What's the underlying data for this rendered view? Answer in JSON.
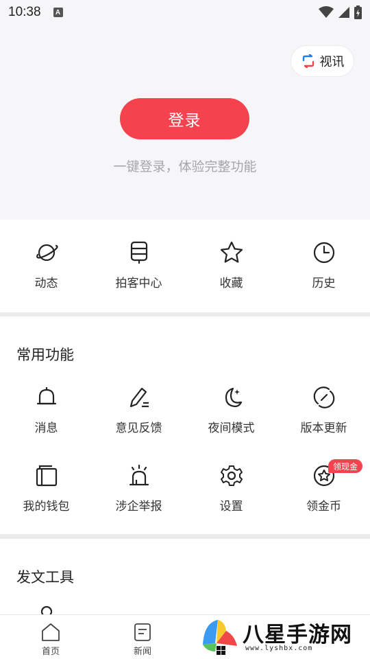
{
  "status_bar": {
    "time": "10:38",
    "a_icon": "A"
  },
  "header": {
    "video_chip_label": "视讯",
    "login_label": "登录",
    "login_hint": "一键登录，体验完整功能"
  },
  "quick_entries": [
    {
      "label": "动态",
      "icon": "planet-icon"
    },
    {
      "label": "拍客中心",
      "icon": "camera-device-icon"
    },
    {
      "label": "收藏",
      "icon": "star-icon"
    },
    {
      "label": "历史",
      "icon": "clock-icon"
    }
  ],
  "common": {
    "title": "常用功能",
    "items": [
      {
        "label": "消息",
        "icon": "bell-icon"
      },
      {
        "label": "意见反馈",
        "icon": "pen-icon"
      },
      {
        "label": "夜间模式",
        "icon": "moon-icon"
      },
      {
        "label": "版本更新",
        "icon": "refresh-icon"
      },
      {
        "label": "我的钱包",
        "icon": "wallet-icon"
      },
      {
        "label": "涉企举报",
        "icon": "alarm-icon"
      },
      {
        "label": "设置",
        "icon": "gear-icon"
      },
      {
        "label": "领金币",
        "icon": "coin-star-icon"
      }
    ],
    "badge": "领现金"
  },
  "tools": {
    "title": "发文工具"
  },
  "bottom_nav": [
    {
      "label": "首页",
      "icon": "home-icon"
    },
    {
      "label": "新闻",
      "icon": "news-icon"
    }
  ],
  "watermark": {
    "text": "八星手游网",
    "url": "www.lyshbx.com"
  },
  "colors": {
    "accent": "#f5424f",
    "hint": "#a6a6ab",
    "page_bg": "#f6f6f8"
  }
}
